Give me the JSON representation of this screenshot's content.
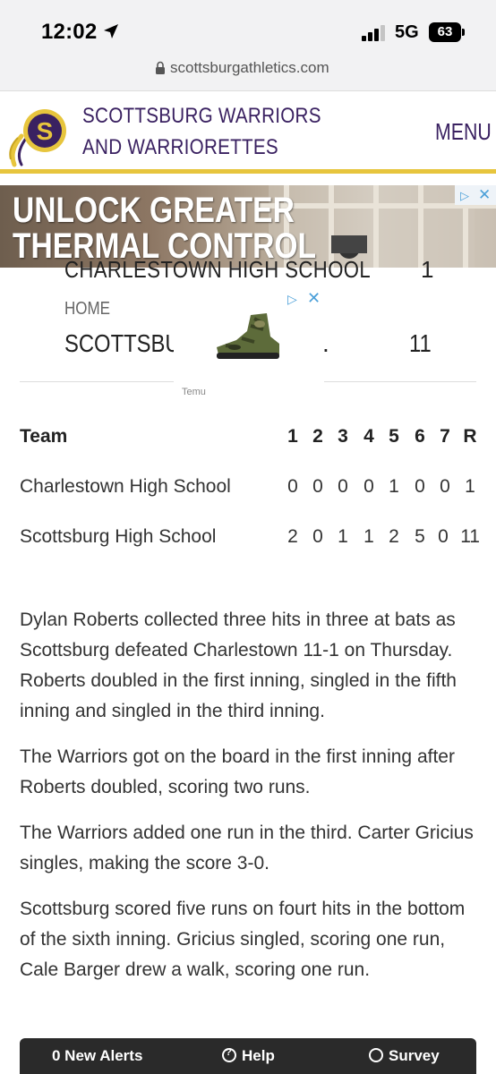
{
  "status_bar": {
    "time": "12:02",
    "network": "5G",
    "battery": "63"
  },
  "browser": {
    "url": "scottsburgathletics.com"
  },
  "site_header": {
    "title": "SCOTTSBURG WARRIORS AND WARRIORETTES",
    "menu_label": "MENU",
    "logo_letter": "S"
  },
  "ad_banner": {
    "headline_line1": "UNLOCK GREATER",
    "headline_line2": "THERMAL CONTROL"
  },
  "overlay_ad": {
    "brand": "Temu"
  },
  "scoreboard": {
    "away_team": "CHARLESTOWN HIGH SCHOOL",
    "away_score": "1",
    "home_label": "HOME",
    "home_team": "SCOTTSBUR",
    "home_team_trailing": ".",
    "home_score": "11"
  },
  "line_score": {
    "header_team": "Team",
    "innings": [
      "1",
      "2",
      "3",
      "4",
      "5",
      "6",
      "7",
      "R"
    ],
    "rows": [
      {
        "team": "Charlestown High School",
        "runs": [
          "0",
          "0",
          "0",
          "0",
          "1",
          "0",
          "0",
          "1"
        ]
      },
      {
        "team": "Scottsburg High School",
        "runs": [
          "2",
          "0",
          "1",
          "1",
          "2",
          "5",
          "0",
          "11"
        ]
      }
    ]
  },
  "article": {
    "paragraphs": [
      "Dylan Roberts collected three hits in three at bats as Scottsburg defeated Charlestown 11-1 on Thursday.  Roberts doubled in the first inning, singled in the fifth inning and singled in the third inning.",
      "The Warriors got on the board in the first inning after Roberts doubled, scoring two runs.",
      "The Warriors added one run in the third. Carter Gricius singles, making the score 3-0.",
      "Scottsburg scored five runs on fourt hits in the bottom of the sixth inning.  Gricius singled, scoring one run, Cale Barger drew a walk, scoring one run."
    ]
  },
  "alert_bar": {
    "alerts_label": "0 New Alerts",
    "help_label": "Help",
    "survey_label": "Survey"
  }
}
